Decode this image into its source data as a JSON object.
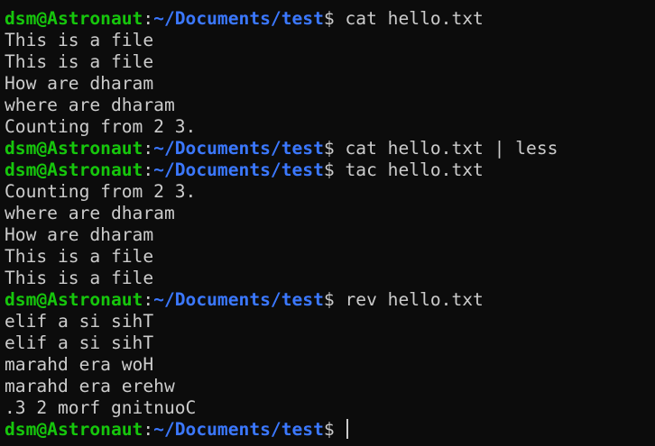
{
  "terminal": {
    "colors": {
      "background": "#0c0c0c",
      "foreground": "#cccccc",
      "user_host": "#16c60c",
      "path": "#3b78ff"
    },
    "lines": [
      {
        "type": "prompt",
        "user": "dsm@Astronaut",
        "colon": ":",
        "path": "~/Documents/test",
        "dollar": "$",
        "command": " cat hello.txt"
      },
      {
        "type": "output",
        "text": "This is a file"
      },
      {
        "type": "output",
        "text": "This is a file"
      },
      {
        "type": "output",
        "text": "How are dharam"
      },
      {
        "type": "output",
        "text": "where are dharam"
      },
      {
        "type": "output",
        "text": "Counting from 2 3."
      },
      {
        "type": "prompt",
        "user": "dsm@Astronaut",
        "colon": ":",
        "path": "~/Documents/test",
        "dollar": "$",
        "command": " cat hello.txt | less"
      },
      {
        "type": "prompt",
        "user": "dsm@Astronaut",
        "colon": ":",
        "path": "~/Documents/test",
        "dollar": "$",
        "command": " tac hello.txt"
      },
      {
        "type": "output",
        "text": "Counting from 2 3."
      },
      {
        "type": "output",
        "text": "where are dharam"
      },
      {
        "type": "output",
        "text": "How are dharam"
      },
      {
        "type": "output",
        "text": "This is a file"
      },
      {
        "type": "output",
        "text": "This is a file"
      },
      {
        "type": "prompt",
        "user": "dsm@Astronaut",
        "colon": ":",
        "path": "~/Documents/test",
        "dollar": "$",
        "command": " rev hello.txt"
      },
      {
        "type": "output",
        "text": "elif a si sihT"
      },
      {
        "type": "output",
        "text": "elif a si sihT"
      },
      {
        "type": "output",
        "text": "marahd era woH"
      },
      {
        "type": "output",
        "text": "marahd era erehw"
      },
      {
        "type": "output",
        "text": ".3 2 morf gnitnuoC"
      },
      {
        "type": "prompt",
        "user": "dsm@Astronaut",
        "colon": ":",
        "path": "~/Documents/test",
        "dollar": "$",
        "command": " ",
        "cursor": true
      }
    ]
  }
}
